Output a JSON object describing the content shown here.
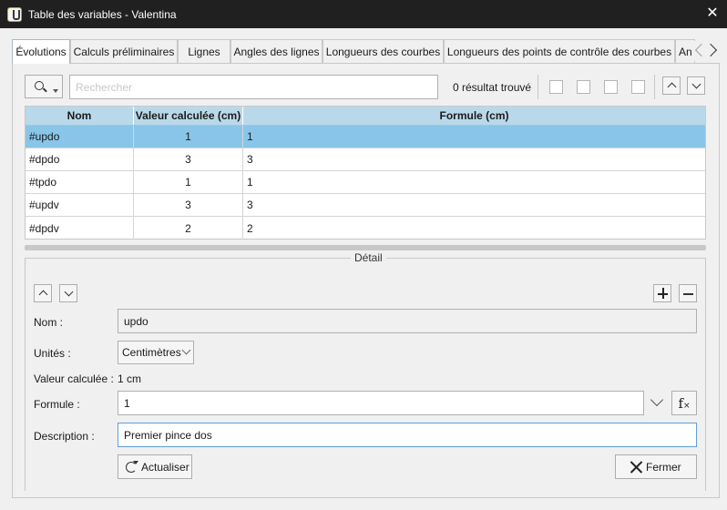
{
  "window": {
    "title": "Table des variables - Valentina"
  },
  "tabs": [
    {
      "label": "Évolutions"
    },
    {
      "label": "Calculs préliminaires"
    },
    {
      "label": "Lignes"
    },
    {
      "label": "Angles des lignes"
    },
    {
      "label": "Longueurs des courbes"
    },
    {
      "label": "Longueurs des points de contrôle des courbes"
    },
    {
      "label": "An"
    }
  ],
  "search": {
    "placeholder": "Rechercher",
    "result_text": "0 résultat trouvé"
  },
  "table": {
    "headers": [
      "Nom",
      "Valeur calculée (cm)",
      "Formule (cm)"
    ],
    "rows": [
      {
        "name": "#updo",
        "value": "1",
        "formula": "1"
      },
      {
        "name": "#dpdo",
        "value": "3",
        "formula": "3"
      },
      {
        "name": "#tpdo",
        "value": "1",
        "formula": "1"
      },
      {
        "name": "#updv",
        "value": "3",
        "formula": "3"
      },
      {
        "name": "#dpdv",
        "value": "2",
        "formula": "2"
      }
    ]
  },
  "detail": {
    "title": "Détail",
    "name_label": "Nom :",
    "name_value": "updo",
    "units_label": "Unités :",
    "units_value": "Centimètres",
    "calc_label": "Valeur calculée :",
    "calc_value": "1 cm",
    "formula_label": "Formule :",
    "formula_value": "1",
    "description_label": "Description :",
    "description_value": "Premier pince dos",
    "refresh_label": "Actualiser",
    "close_label": "Fermer"
  }
}
